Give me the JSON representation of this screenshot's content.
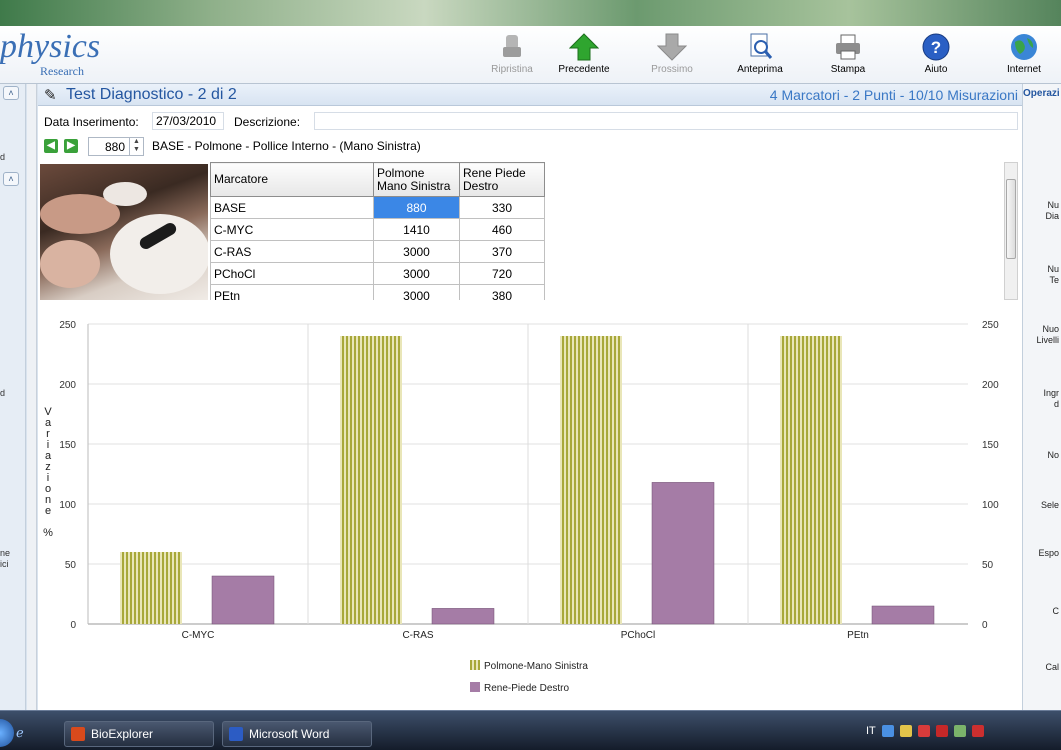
{
  "logo": {
    "main": "physics",
    "sub": "Research"
  },
  "toolbar": [
    {
      "label": "Ripristina",
      "icon": "restore-icon",
      "disabled": true
    },
    {
      "label": "Precedente",
      "icon": "arrow-up-icon",
      "disabled": false
    },
    {
      "label": "Prossimo",
      "icon": "arrow-down-icon",
      "disabled": true
    },
    {
      "label": "Anteprima",
      "icon": "preview-icon",
      "disabled": false
    },
    {
      "label": "Stampa",
      "icon": "printer-icon",
      "disabled": false
    },
    {
      "label": "Aiuto",
      "icon": "help-icon",
      "disabled": false
    },
    {
      "label": "Internet",
      "icon": "globe-icon",
      "disabled": false
    }
  ],
  "header": {
    "title": "Test Diagnostico - 2 di 2",
    "info": "4 Marcatori - 2 Punti - 10/10 Misurazioni"
  },
  "form": {
    "date_label": "Data Inserimento:",
    "date_value": "27/03/2010",
    "desc_label": "Descrizione:",
    "desc_value": ""
  },
  "measure": {
    "spinner_value": "880",
    "description": "BASE - Polmone - Pollice Interno - (Mano Sinistra)"
  },
  "table": {
    "headers": [
      "Marcatore",
      "Polmone Mano Sinistra",
      "Rene Piede Destro"
    ],
    "rows": [
      [
        "BASE",
        "880",
        "330"
      ],
      [
        "C-MYC",
        "1410",
        "460"
      ],
      [
        "C-RAS",
        "3000",
        "370"
      ],
      [
        "PChoCl",
        "3000",
        "720"
      ],
      [
        "PEtn",
        "3000",
        "380"
      ]
    ]
  },
  "chart_data": {
    "type": "bar",
    "categories": [
      "C-MYC",
      "C-RAS",
      "PChoCl",
      "PEtn"
    ],
    "series": [
      {
        "name": "Polmone-Mano Sinistra",
        "values": [
          60,
          240,
          240,
          240
        ],
        "color": "#a8a83a"
      },
      {
        "name": "Rene-Piede Destro",
        "values": [
          40,
          13,
          118,
          15
        ],
        "color": "#a57ca6"
      }
    ],
    "ylabel": "Variazione %",
    "yticks": [
      0,
      50,
      100,
      150,
      200,
      250
    ],
    "ylim": [
      0,
      250
    ],
    "legend": "bottom",
    "grid": true
  },
  "rightpanel": {
    "header": "Operazi",
    "items": [
      "Nu\nDia",
      "Nu\nTe",
      "Nuo\nLivelli",
      "Ingr\nd",
      "No",
      "Sele",
      "Espo",
      "C",
      "Cal"
    ]
  },
  "leftpanel": {
    "items": [
      "d",
      "d",
      "ne\nici"
    ]
  },
  "taskbar": {
    "items": [
      "BioExplorer",
      "Microsoft Word"
    ],
    "lang": "IT"
  }
}
